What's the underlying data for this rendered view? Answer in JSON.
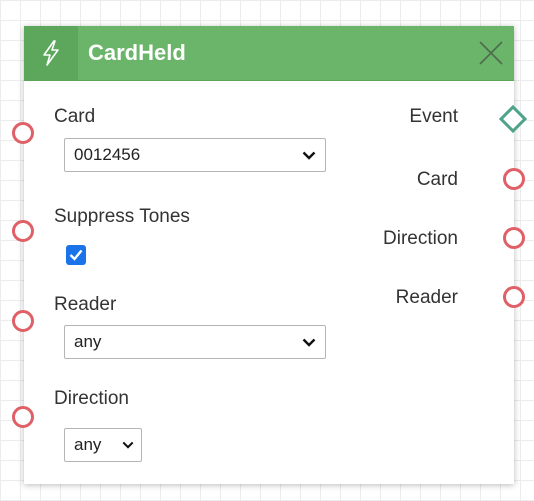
{
  "node": {
    "title": "CardHeld",
    "header_color": "#6ab56a",
    "icons": {
      "header": "lightning-bolt-icon",
      "close": "close-icon"
    }
  },
  "inputs": {
    "card": {
      "label": "Card",
      "value": "0012456"
    },
    "suppress_tones": {
      "label": "Suppress Tones",
      "checked": true
    },
    "reader": {
      "label": "Reader",
      "value": "any"
    },
    "direction": {
      "label": "Direction",
      "value": "any"
    }
  },
  "outputs": {
    "event": "Event",
    "card": "Card",
    "direction": "Direction",
    "reader": "Reader"
  },
  "colors": {
    "input_port": "#e06068",
    "event_port": "#4ea38a",
    "checkbox": "#1a73e8"
  }
}
